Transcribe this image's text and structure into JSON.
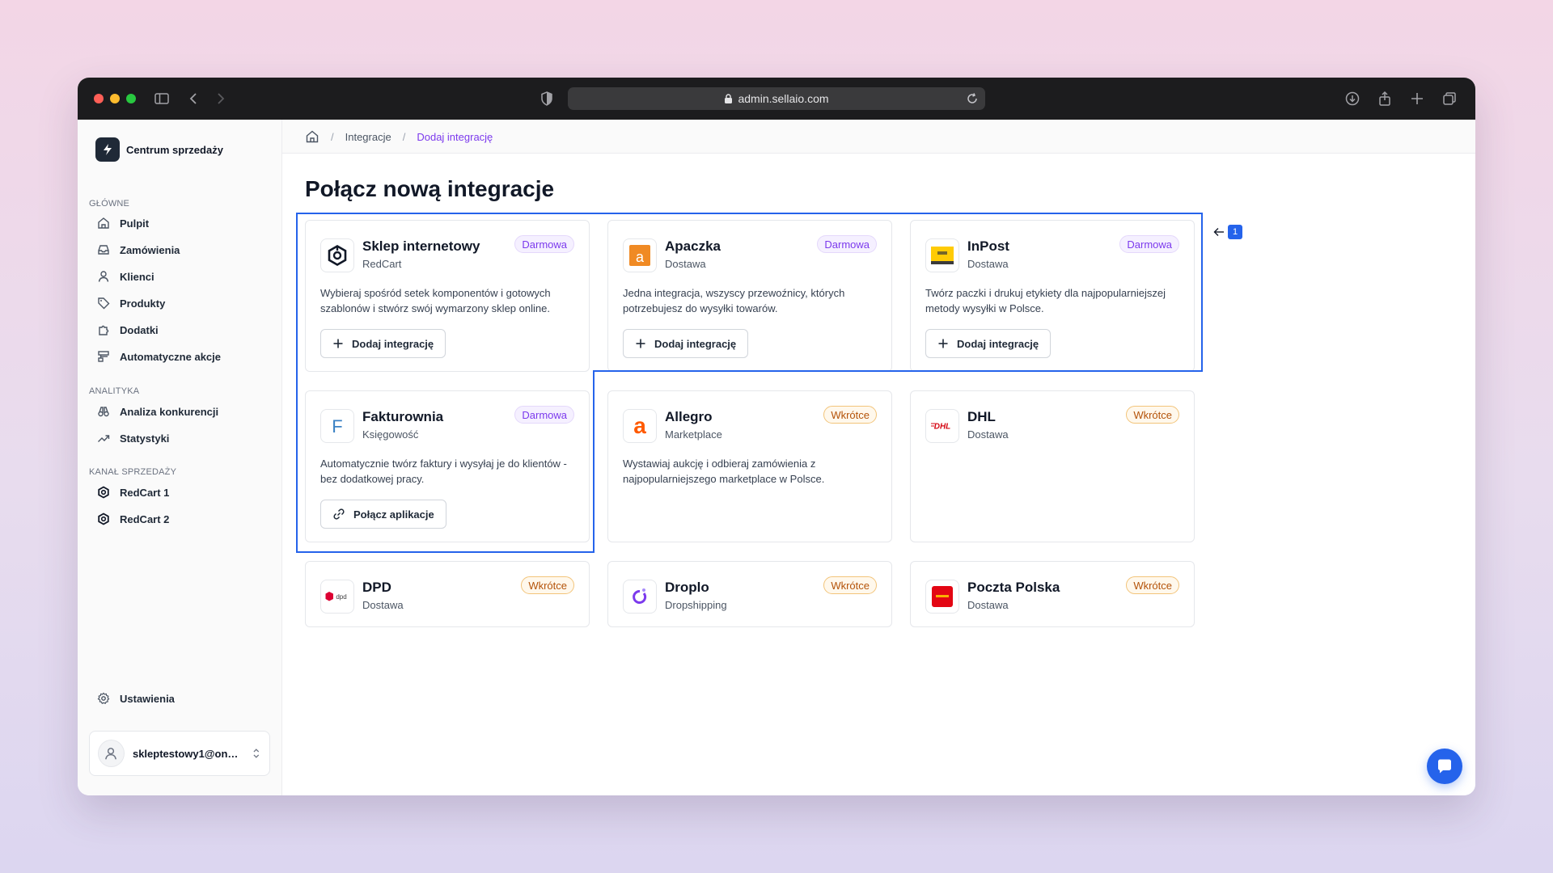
{
  "browser": {
    "url": "admin.sellaio.com"
  },
  "sidebar": {
    "brand": "Centrum sprzedaży",
    "sections": [
      {
        "label": "GŁÓWNE",
        "items": [
          "Pulpit",
          "Zamówienia",
          "Klienci",
          "Produkty",
          "Dodatki",
          "Automatyczne akcje"
        ]
      },
      {
        "label": "ANALITYKA",
        "items": [
          "Analiza konkurencji",
          "Statystyki"
        ]
      },
      {
        "label": "KANAŁ SPRZEDAŻY",
        "items": [
          "RedCart 1",
          "RedCart 2"
        ]
      }
    ],
    "settings": "Ustawienia",
    "user_email": "skleptestowy1@onet.pl"
  },
  "breadcrumb": {
    "items": [
      "Integracje",
      "Dodaj integrację"
    ]
  },
  "page": {
    "title": "Połącz nową integracje"
  },
  "cards": [
    {
      "title": "Sklep internetowy",
      "subtitle": "RedCart",
      "badge": "Darmowa",
      "desc": "Wybieraj spośród setek komponentów i gotowych szablonów i stwórz swój wymarzony sklep online.",
      "button": "Dodaj integrację",
      "logo": "redcart-logo-icon"
    },
    {
      "title": "Apaczka",
      "subtitle": "Dostawa",
      "badge": "Darmowa",
      "desc": "Jedna integracja, wszyscy przewoźnicy, których potrzebujesz do wysyłki towarów.",
      "button": "Dodaj integrację",
      "logo": "apaczka-logo-icon"
    },
    {
      "title": "InPost",
      "subtitle": "Dostawa",
      "badge": "Darmowa",
      "desc": "Twórz paczki i drukuj etykiety dla najpopularniejszej metody wysyłki w Polsce.",
      "button": "Dodaj integrację",
      "logo": "inpost-logo-icon"
    },
    {
      "title": "Fakturownia",
      "subtitle": "Księgowość",
      "badge": "Darmowa",
      "desc": "Automatycznie twórz faktury i wysyłaj je do klientów - bez dodatkowej pracy.",
      "button": "Połącz aplikacje",
      "logo": "fakturownia-logo-icon"
    },
    {
      "title": "Allegro",
      "subtitle": "Marketplace",
      "badge": "Wkrótce",
      "desc": "Wystawiaj aukcję i odbieraj zamówienia z najpopularniejszego marketplace w Polsce.",
      "button": "",
      "logo": "allegro-logo-icon"
    },
    {
      "title": "DHL",
      "subtitle": "Dostawa",
      "badge": "Wkrótce",
      "desc": "",
      "button": "",
      "logo": "dhl-logo-icon"
    },
    {
      "title": "DPD",
      "subtitle": "Dostawa",
      "badge": "Wkrótce",
      "desc": "",
      "button": "",
      "logo": "dpd-logo-icon"
    },
    {
      "title": "Droplo",
      "subtitle": "Dropshipping",
      "badge": "Wkrótce",
      "desc": "",
      "button": "",
      "logo": "droplo-logo-icon"
    },
    {
      "title": "Poczta Polska",
      "subtitle": "Dostawa",
      "badge": "Wkrótce",
      "desc": "",
      "button": "",
      "logo": "poczta-polska-logo-icon"
    }
  ],
  "annotation": {
    "marker_number": "1"
  },
  "colors": {
    "accent": "#7c3aed",
    "highlight": "#2563eb",
    "soon_badge": "#b45309"
  }
}
